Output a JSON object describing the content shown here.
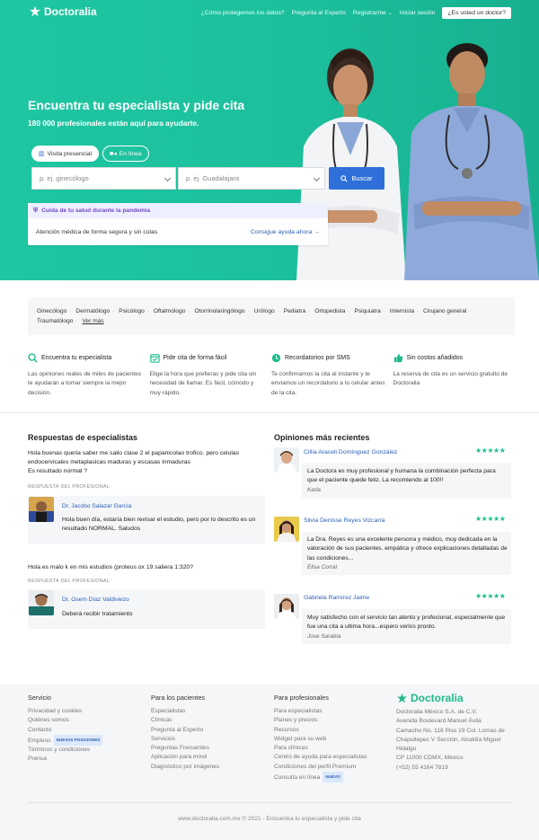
{
  "brand": {
    "name": "Doctoralia",
    "color": "#20c4a1"
  },
  "nav": {
    "items": [
      "¿Cómo protegemos los datos?",
      "Pregunta al Experto",
      "Registrarme",
      "Iniciar sesión"
    ],
    "doctor_btn": "¿Es usted un doctor?"
  },
  "hero": {
    "title": "Encuentra tu especialista y pide cita",
    "subtitle": "180 000 profesionales están aquí para ayudarte.",
    "tab_presencial": "Visita presencial",
    "tab_online": "En línea",
    "specialty_placeholder": "p. ej. ginecólogo",
    "city_placeholder": "p. ej. Guadalajara",
    "search_btn": "Buscar",
    "pandemic_title": "Cuida de tu salud durante la pandemia",
    "pandemic_text": "Atención médica de forma segura y sin colas",
    "pandemic_link": "Consigue ayuda ahora"
  },
  "specialties": {
    "items": [
      "Ginecólogo",
      "Dermatólogo",
      "Psicólogo",
      "Oftalmólogo",
      "Otorrinolaringólogo",
      "Urólogo",
      "Pediatra",
      "Ortopedista",
      "Psiquiatra",
      "Internista",
      "Cirujano general",
      "Traumatólogo"
    ],
    "more": "Ver más"
  },
  "features": [
    {
      "icon": "search-icon",
      "title": "Encuentra tu especialista",
      "desc": "Las opiniones reales de miles de pacientes te ayudarán a tomar siempre la mejor decisión."
    },
    {
      "icon": "calendar-check-icon",
      "title": "Pide cita de forma fácil",
      "desc": "Elige la hora que prefieras y pide cita sin necesidad de llamar. Es fácil, cómodo y muy rápido."
    },
    {
      "icon": "clock-icon",
      "title": "Recordatorios por SMS",
      "desc": "Te confirmamos la cita al instante y te enviamos un recordatorio a tu celular antes de la cita."
    },
    {
      "icon": "thumbs-up-icon",
      "title": "Sin costos añadidos",
      "desc": "La reserva de cita es un servicio gratuito de Doctoralia"
    }
  ],
  "qa": {
    "title": "Respuestas de especialistas",
    "answer_label": "RESPUESTA DEL PROFESIONAL",
    "items": [
      {
        "question": "Hola buenas queria saber me salio clase 2 el papanicolao trofico. pero celulas endocervicales metaplasicas maduras y escasas inmaduras\nEs resultado normal ?",
        "doctor": "Dr. Jacobo Salazar García",
        "answer": "Hola buen día, estaría bien revisar el estudio, pero por lo descrito es un resultado NORMAL. Saludos"
      },
      {
        "question": "Hola es malo k en mis estudios (proteus ox 19 saliera 1:320?",
        "doctor": "Dr. Osem Díaz Valdiviezo",
        "answer": "Deberá recibir tratamiento"
      }
    ]
  },
  "reviews": {
    "title": "Opiniones más recientes",
    "stars": "★★★★★",
    "items": [
      {
        "doctor": "Cillia Araceli Domínguez González",
        "text": "La Doctora es muy profesional y humana la combinación perfecta para que el paciente quede feliz. La recomiendo al 100!!",
        "author": "Karla"
      },
      {
        "doctor": "Silvia Denisse Reyes Vizcarra",
        "text": "La Dra. Reyes es una excelente persona y médico, muy dedicada en la valoración de sus pacientes, empática y ofrece explicaciones detalladas de las condiciones...",
        "author": "Elisa Corral"
      },
      {
        "doctor": "Gabriela Ramírez Jaime",
        "text": "Muy satisfecho con el servicio tan atento y profecional, especialmente que fue una cita a ultima hora...espero verlos pronto.",
        "author": "Jose Sarabia"
      }
    ]
  },
  "footer": {
    "servicio": {
      "title": "Servicio",
      "items": [
        "Privacidad y cookies",
        "Quiénes somos",
        "Contacto",
        "Empleos",
        "Términos y condiciones",
        "Prensa"
      ],
      "tag": "NUEVAS POSICIONES"
    },
    "pacientes": {
      "title": "Para los pacientes",
      "items": [
        "Especialistas",
        "Clínicas",
        "Pregunta al Experto",
        "Servicios",
        "Preguntas Frecuentes",
        "Aplicación para móvil",
        "Diagnóstico por imágenes"
      ]
    },
    "profesionales": {
      "title": "Para profesionales",
      "items": [
        "Para especialistas",
        "Planes y precios",
        "Recursos",
        "Widget para su web",
        "Para clínicas",
        "Centro de ayuda para especialistas",
        "Condiciones del perfil Premium",
        "Consulta en línea"
      ],
      "tag": "NUEVO"
    },
    "company": [
      "Doctoralia México S.A. de C.V.",
      "Avenida Boulevard Manuel Ávila",
      "Camacho No. 118 Piso 19 Col. Lomas de",
      "Chapultepec V Sección, Alcaldía Miguel",
      "Hidalgo",
      "CP 11000 CDMX, México",
      "(+52) 55 4164 7819"
    ],
    "copyright": "www.doctoralia.com.mx © 2021 - Encuentra tu especialista y pide cita"
  }
}
